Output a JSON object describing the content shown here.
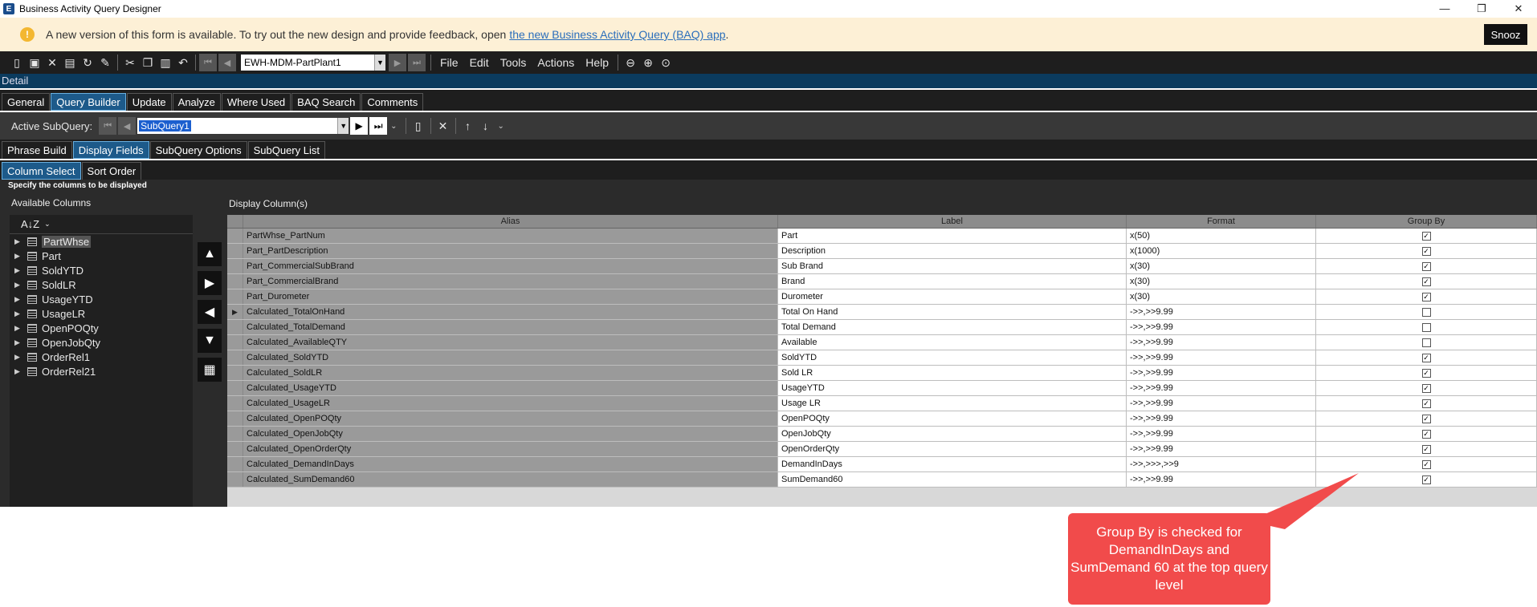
{
  "window": {
    "title": "Business Activity Query Designer",
    "app_icon": "E",
    "controls": [
      "—",
      "❐",
      "✕"
    ]
  },
  "banner": {
    "text": "A new version of this form is available. To try out the new design and provide feedback, open",
    "link": "the new Business Activity Query (BAQ) app",
    "link_suffix": ".",
    "snooze_label": "Snooz",
    "icon": "exclamation-icon"
  },
  "toolbar": {
    "query_id": "EWH-MDM-PartPlant1",
    "menus": [
      "File",
      "Edit",
      "Tools",
      "Actions",
      "Help"
    ]
  },
  "detail_label": "Detail",
  "main_tabs": [
    "General",
    "Query Builder",
    "Update",
    "Analyze",
    "Where Used",
    "BAQ Search",
    "Comments"
  ],
  "main_tab_active": 1,
  "subquery": {
    "label": "Active SubQuery:",
    "value": "SubQuery1"
  },
  "sub_tabs": [
    "Phrase Build",
    "Display Fields",
    "SubQuery Options",
    "SubQuery List"
  ],
  "sub_tab_active": 1,
  "sub_tabs2": [
    "Column Select",
    "Sort Order"
  ],
  "sub_tab2_active": 0,
  "hint": "Specify the columns to be displayed",
  "available": {
    "label": "Available Columns",
    "sort_icon": "A↓Z",
    "items": [
      "PartWhse",
      "Part",
      "SoldYTD",
      "SoldLR",
      "UsageYTD",
      "UsageLR",
      "OpenPOQty",
      "OpenJobQty",
      "OrderRel1",
      "OrderRel21"
    ]
  },
  "display": {
    "label": "Display Column(s)",
    "headers": [
      "Alias",
      "Label",
      "Format",
      "Group By"
    ],
    "rows": [
      {
        "alias": "PartWhse_PartNum",
        "label": "Part",
        "format": "x(50)",
        "group": true
      },
      {
        "alias": "Part_PartDescription",
        "label": "Description",
        "format": "x(1000)",
        "group": true
      },
      {
        "alias": "Part_CommercialSubBrand",
        "label": "Sub Brand",
        "format": "x(30)",
        "group": true
      },
      {
        "alias": "Part_CommercialBrand",
        "label": "Brand",
        "format": "x(30)",
        "group": true
      },
      {
        "alias": "Part_Durometer",
        "label": "Durometer",
        "format": "x(30)",
        "group": true
      },
      {
        "alias": "Calculated_TotalOnHand",
        "label": "Total On Hand",
        "format": "->>,>>9.99",
        "group": false
      },
      {
        "alias": "Calculated_TotalDemand",
        "label": "Total Demand",
        "format": "->>,>>9.99",
        "group": false
      },
      {
        "alias": "Calculated_AvailableQTY",
        "label": "Available",
        "format": "->>,>>9.99",
        "group": false
      },
      {
        "alias": "Calculated_SoldYTD",
        "label": "SoldYTD",
        "format": "->>,>>9.99",
        "group": true
      },
      {
        "alias": "Calculated_SoldLR",
        "label": "Sold LR",
        "format": "->>,>>9.99",
        "group": true
      },
      {
        "alias": "Calculated_UsageYTD",
        "label": "UsageYTD",
        "format": "->>,>>9.99",
        "group": true
      },
      {
        "alias": "Calculated_UsageLR",
        "label": "Usage LR",
        "format": "->>,>>9.99",
        "group": true
      },
      {
        "alias": "Calculated_OpenPOQty",
        "label": "OpenPOQty",
        "format": "->>,>>9.99",
        "group": true
      },
      {
        "alias": "Calculated_OpenJobQty",
        "label": "OpenJobQty",
        "format": "->>,>>9.99",
        "group": true
      },
      {
        "alias": "Calculated_OpenOrderQty",
        "label": "OpenOrderQty",
        "format": "->>,>>9.99",
        "group": true
      },
      {
        "alias": "Calculated_DemandInDays",
        "label": "DemandInDays",
        "format": "->>,>>>,>>9",
        "group": true
      },
      {
        "alias": "Calculated_SumDemand60",
        "label": "SumDemand60",
        "format": "->>,>>9.99",
        "group": true
      }
    ],
    "current_row": 5
  },
  "callout": {
    "text": "Group By is checked for DemandInDays and SumDemand 60 at the top query level",
    "color": "#f14b4b"
  }
}
